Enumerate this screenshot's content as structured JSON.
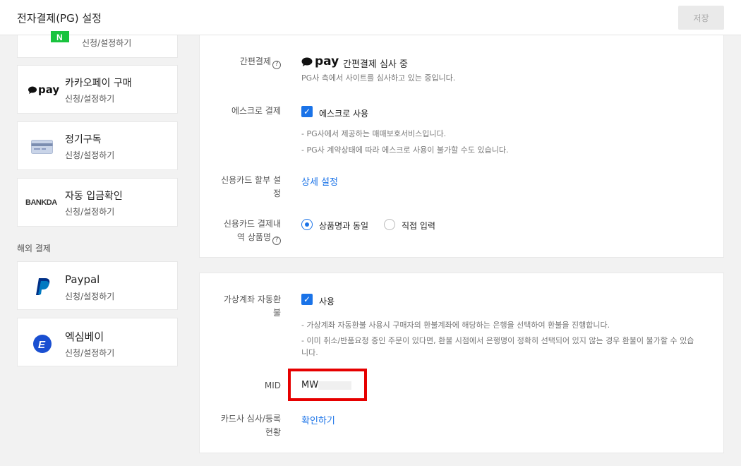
{
  "header": {
    "title": "전자결제(PG) 설정",
    "save_label": "저장"
  },
  "sidebar": {
    "cards": [
      {
        "icon": "naver-pay-icon",
        "sub": "신청/설정하기"
      },
      {
        "icon": "kakao-pay-icon",
        "logo_text": "pay",
        "name": "카카오페이 구매",
        "sub": "신청/설정하기"
      },
      {
        "icon": "credit-card-icon",
        "name": "정기구독",
        "sub": "신청/설정하기"
      },
      {
        "icon": "bankda-icon",
        "logo_text": "BANKDA",
        "name": "자동 입금확인",
        "sub": "신청/설정하기"
      }
    ],
    "overseas_label": "해외 결제",
    "overseas": [
      {
        "icon": "paypal-icon",
        "name": "Paypal",
        "sub": "신청/설정하기"
      },
      {
        "icon": "eximbay-icon",
        "name": "엑심베이",
        "sub": "신청/설정하기"
      }
    ]
  },
  "panel1": {
    "easy_pay_label": "간편결제",
    "easy_pay_logo": "pay",
    "easy_pay_status": "간편결제 심사 중",
    "easy_pay_hint": "PG사 측에서 사이트를 심사하고 있는 중입니다.",
    "escrow_label": "에스크로 결제",
    "escrow_checkbox": "에스크로 사용",
    "escrow_hints": [
      "- PG사에서 제공하는 매매보호서비스입니다.",
      "- PG사 계약상태에 따라 에스크로 사용이 불가할 수도 있습니다."
    ],
    "installment_label_1": "신용카드 할부 설",
    "installment_label_2": "정",
    "installment_link": "상세 설정",
    "product_label_1": "신용카드 결제내",
    "product_label_2": "역 상품명",
    "radio_same": "상품명과 동일",
    "radio_direct": "직접 입력"
  },
  "panel2": {
    "refund_label_1": "가상계좌 자동환",
    "refund_label_2": "불",
    "refund_checkbox": "사용",
    "refund_hints": [
      "- 가상계좌 자동환불 사용시 구매자의 환불계좌에 해당하는 은행을 선택하여 환불을 진행합니다.",
      "- 이미 취소/반품요청 중인 주문이 있다면, 환불 시점에서 은행명이 정확히 선택되어 있지 않는 경우 환불이 불가할 수 있습",
      "니다."
    ],
    "mid_label": "MID",
    "mid_value": "MW",
    "card_review_label_1": "카드사 심사/등록",
    "card_review_label_2": "현황",
    "card_review_link": "확인하기"
  }
}
